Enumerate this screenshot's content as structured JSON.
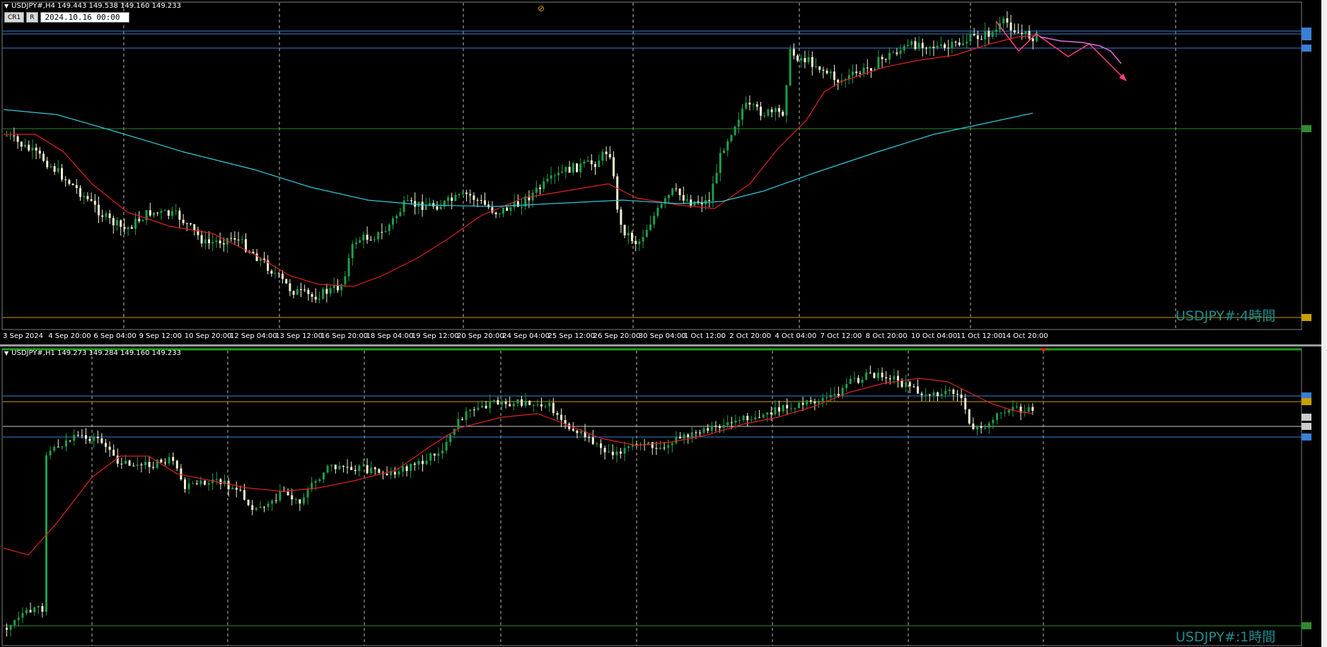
{
  "top_chart": {
    "info": "USDJPY#,H4  149.443 149.538 149.160 149.233",
    "toolbar": {
      "btn1": "CR1",
      "btn2": "R",
      "date": "2024.10.16 00:00"
    },
    "watermark": "USDJPY#:4時間",
    "x_labels": [
      "3 Sep 2024",
      "4 Sep 20:00",
      "6 Sep 04:00",
      "9 Sep 12:00",
      "10 Sep 20:00",
      "12 Sep 04:00",
      "13 Sep 12:00",
      "16 Sep 20:00",
      "18 Sep 04:00",
      "19 Sep 12:00",
      "20 Sep 20:00",
      "24 Sep 04:00",
      "25 Sep 12:00",
      "26 Sep 20:00",
      "30 Sep 04:00",
      "1 Oct 12:00",
      "2 Oct 20:00",
      "4 Oct 04:00",
      "7 Oct 12:00",
      "8 Oct 20:00",
      "10 Oct 04:00",
      "11 Oct 12:00",
      "14 Oct 20:00"
    ],
    "colors": {
      "bull": "#1f9e4a",
      "bear": "#f2f2d2",
      "ma_fast": "#e02020",
      "ma_slow": "#30c8d8",
      "forecast": "#ff3d7f",
      "forecast_alt": "#e070e0",
      "hline_blue": "#3a7fd6",
      "hline_green": "#2e8b2e",
      "hline_yellow": "#c9a000"
    }
  },
  "bottom_chart": {
    "info": "USDJPY#,H1  149.273 149.284 149.160 149.233",
    "watermark": "USDJPY#:1時間",
    "colors": {
      "hline_blue": "#3a7fd6",
      "hline_yellow": "#c9a000",
      "hline_white": "#cccccc",
      "hline_green": "#2e8b2e",
      "ma": "#e02020"
    }
  }
}
